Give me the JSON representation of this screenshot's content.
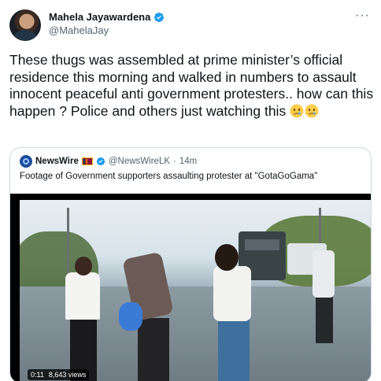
{
  "author": {
    "display_name": "Mahela Jayawardena",
    "handle": "@MahelaJay",
    "verified": true,
    "avatar_icon": "profile-photo"
  },
  "more_icon": "more-horizontal-icon",
  "more_glyph": "···",
  "tweet": {
    "text": "These thugs was assembled at prime minister’s official residence this morning and walked in numbers to assault innocent peaceful anti government protesters.. how can this happen ? Police and others just watching this",
    "emojis": [
      "crying-face",
      "crying-face"
    ]
  },
  "quoted_tweet": {
    "display_name": "NewsWire",
    "flag": "sri-lanka-flag",
    "verified": true,
    "handle": "@NewsWireLK",
    "separator": "·",
    "time": "14m",
    "text": "Footage of Government supporters assaulting protester at \"GotaGoGama\"",
    "video": {
      "duration": "0:11",
      "views": "8,643 views"
    }
  },
  "colors": {
    "text_primary": "#0f1419",
    "text_secondary": "#536471",
    "verified_blue": "#1d9bf0",
    "border": "#cfd9de"
  }
}
